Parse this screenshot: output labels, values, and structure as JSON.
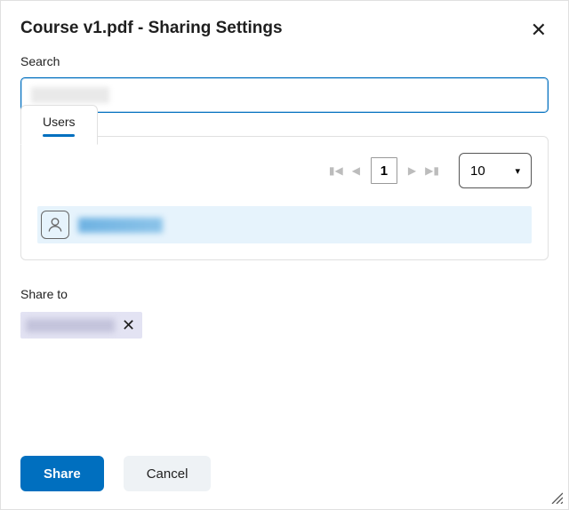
{
  "title": "Course v1.pdf - Sharing Settings",
  "search": {
    "label": "Search",
    "value": ""
  },
  "tabs": {
    "users_label": "Users"
  },
  "pager": {
    "current_page": "1",
    "page_size": "10"
  },
  "users": [
    {
      "name": ""
    }
  ],
  "share_to": {
    "label": "Share to",
    "chips": [
      {
        "name": ""
      }
    ]
  },
  "footer": {
    "share_label": "Share",
    "cancel_label": "Cancel"
  }
}
